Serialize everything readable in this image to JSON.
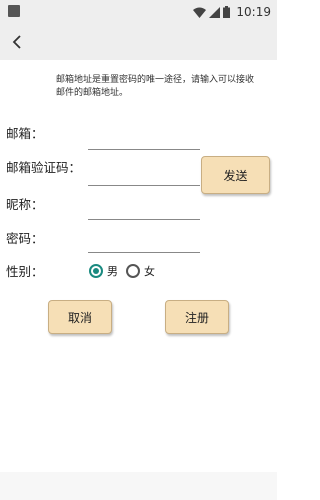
{
  "status_bar": {
    "time": "10:19"
  },
  "notice": "邮箱地址是重置密码的唯一途径，请输入可以接收邮件的邮箱地址。",
  "form": {
    "email_label": "邮箱：",
    "email_value": "",
    "code_label": "邮箱验证码：",
    "code_value": "",
    "send_label": "发送",
    "nickname_label": "昵称：",
    "nickname_value": "",
    "password_label": "密码：",
    "password_value": "",
    "gender_label": "性别：",
    "gender_options": [
      "男",
      "女"
    ],
    "gender_selected": "男"
  },
  "actions": {
    "cancel_label": "取消",
    "register_label": "注册"
  },
  "colors": {
    "accent": "#1a8a80",
    "button_bg": "#f6dfb6",
    "toolbar_bg": "#eeeeee"
  }
}
